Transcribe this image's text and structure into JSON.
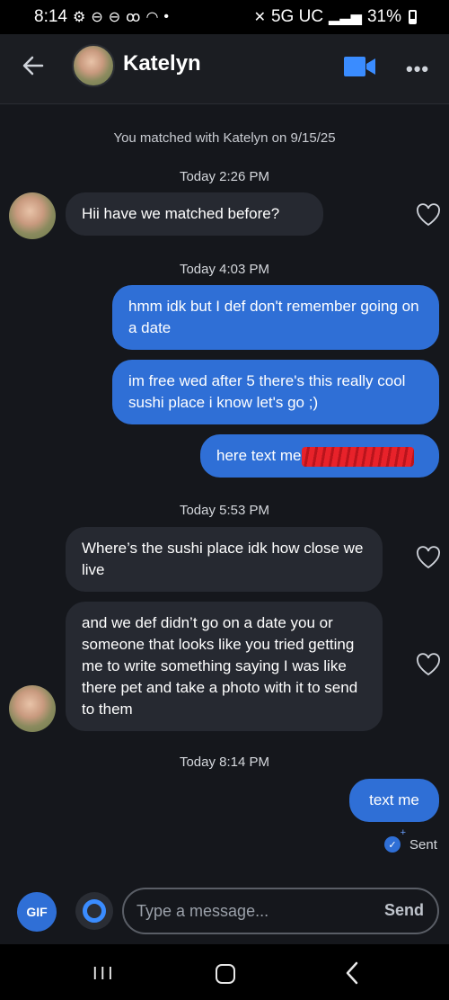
{
  "status_bar": {
    "time": "8:14",
    "network": "5G UC",
    "battery": "31%"
  },
  "header": {
    "name": "Katelyn",
    "back_icon": "arrow-left-icon",
    "video_icon": "video-camera-icon",
    "more_icon": "more-dots-icon"
  },
  "conversation": {
    "match_note": "You matched with Katelyn on 9/15/25",
    "time_1": "Today 2:26 PM",
    "msg_1": "Hii have we matched before?",
    "time_2": "Today 4:03 PM",
    "msg_2": "hmm idk but I def don't remember going on a date",
    "msg_3": "im free wed after 5 there's this really cool sushi place i know let's go ;)",
    "msg_4": "here text me",
    "time_3": "Today 5:53 PM",
    "msg_5": "Where’s the sushi place idk how close we live",
    "msg_6": "and we def didn’t go on a date you or someone that looks like you tried getting me to write something saying I was like there pet and take a photo with it to send to them",
    "time_4": "Today 8:14 PM",
    "msg_7": "text me",
    "sent_status": "Sent"
  },
  "composer": {
    "gif_label": "GIF",
    "placeholder": "Type a message...",
    "send_label": "Send"
  },
  "colors": {
    "background": "#15171c",
    "incoming_bubble": "#262931",
    "outgoing_bubble": "#2f6fd6",
    "accent": "#2f6fd6"
  }
}
